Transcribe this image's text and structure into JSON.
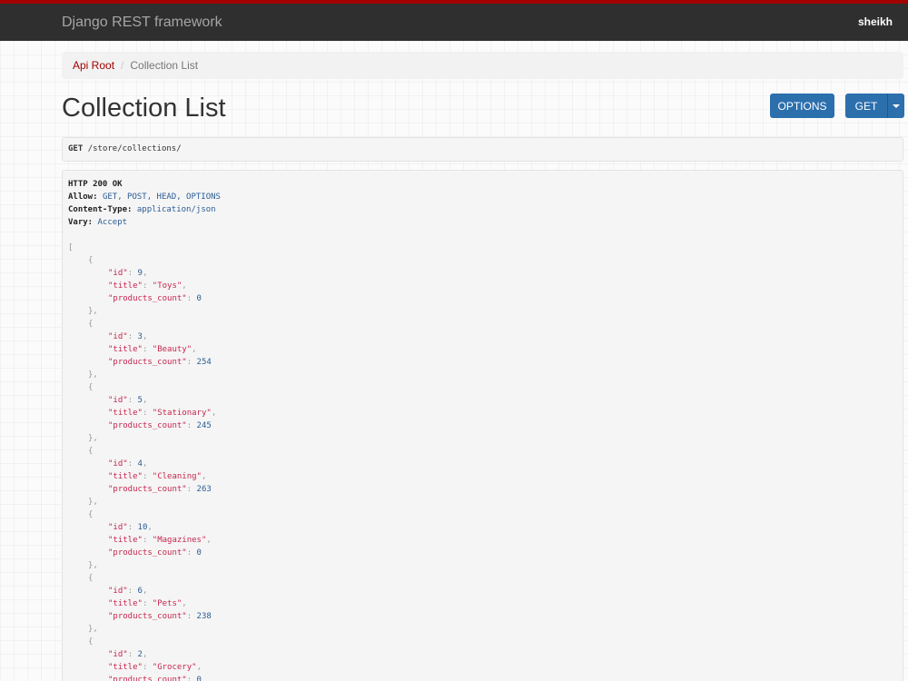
{
  "navbar": {
    "brand": "Django REST framework",
    "user": "sheikh"
  },
  "breadcrumb": {
    "root": "Api Root",
    "separator": "/",
    "current": "Collection List"
  },
  "page": {
    "title": "Collection List"
  },
  "buttons": {
    "options": "OPTIONS",
    "get": "GET"
  },
  "request": {
    "method": "GET",
    "path": "/store/collections/"
  },
  "response": {
    "status": "HTTP 200 OK",
    "headers": [
      {
        "name": "Allow:",
        "value": "GET, POST, HEAD, OPTIONS"
      },
      {
        "name": "Content-Type:",
        "value": "application/json"
      },
      {
        "name": "Vary:",
        "value": "Accept"
      }
    ],
    "key_id": "\"id\"",
    "key_title": "\"title\"",
    "key_products_count": "\"products_count\"",
    "items": [
      {
        "id": "9",
        "title": "\"Toys\"",
        "products_count": "0"
      },
      {
        "id": "3",
        "title": "\"Beauty\"",
        "products_count": "254"
      },
      {
        "id": "5",
        "title": "\"Stationary\"",
        "products_count": "245"
      },
      {
        "id": "4",
        "title": "\"Cleaning\"",
        "products_count": "263"
      },
      {
        "id": "10",
        "title": "\"Magazines\"",
        "products_count": "0"
      },
      {
        "id": "6",
        "title": "\"Pets\"",
        "products_count": "238"
      },
      {
        "id": "2",
        "title": "\"Grocery\"",
        "products_count": "0"
      }
    ]
  },
  "colors": {
    "accent": "#a30000",
    "navbar": "#2f2f2f",
    "button": "#2c6fad",
    "json_key": "#c7254e",
    "json_number": "#2a5d95"
  }
}
